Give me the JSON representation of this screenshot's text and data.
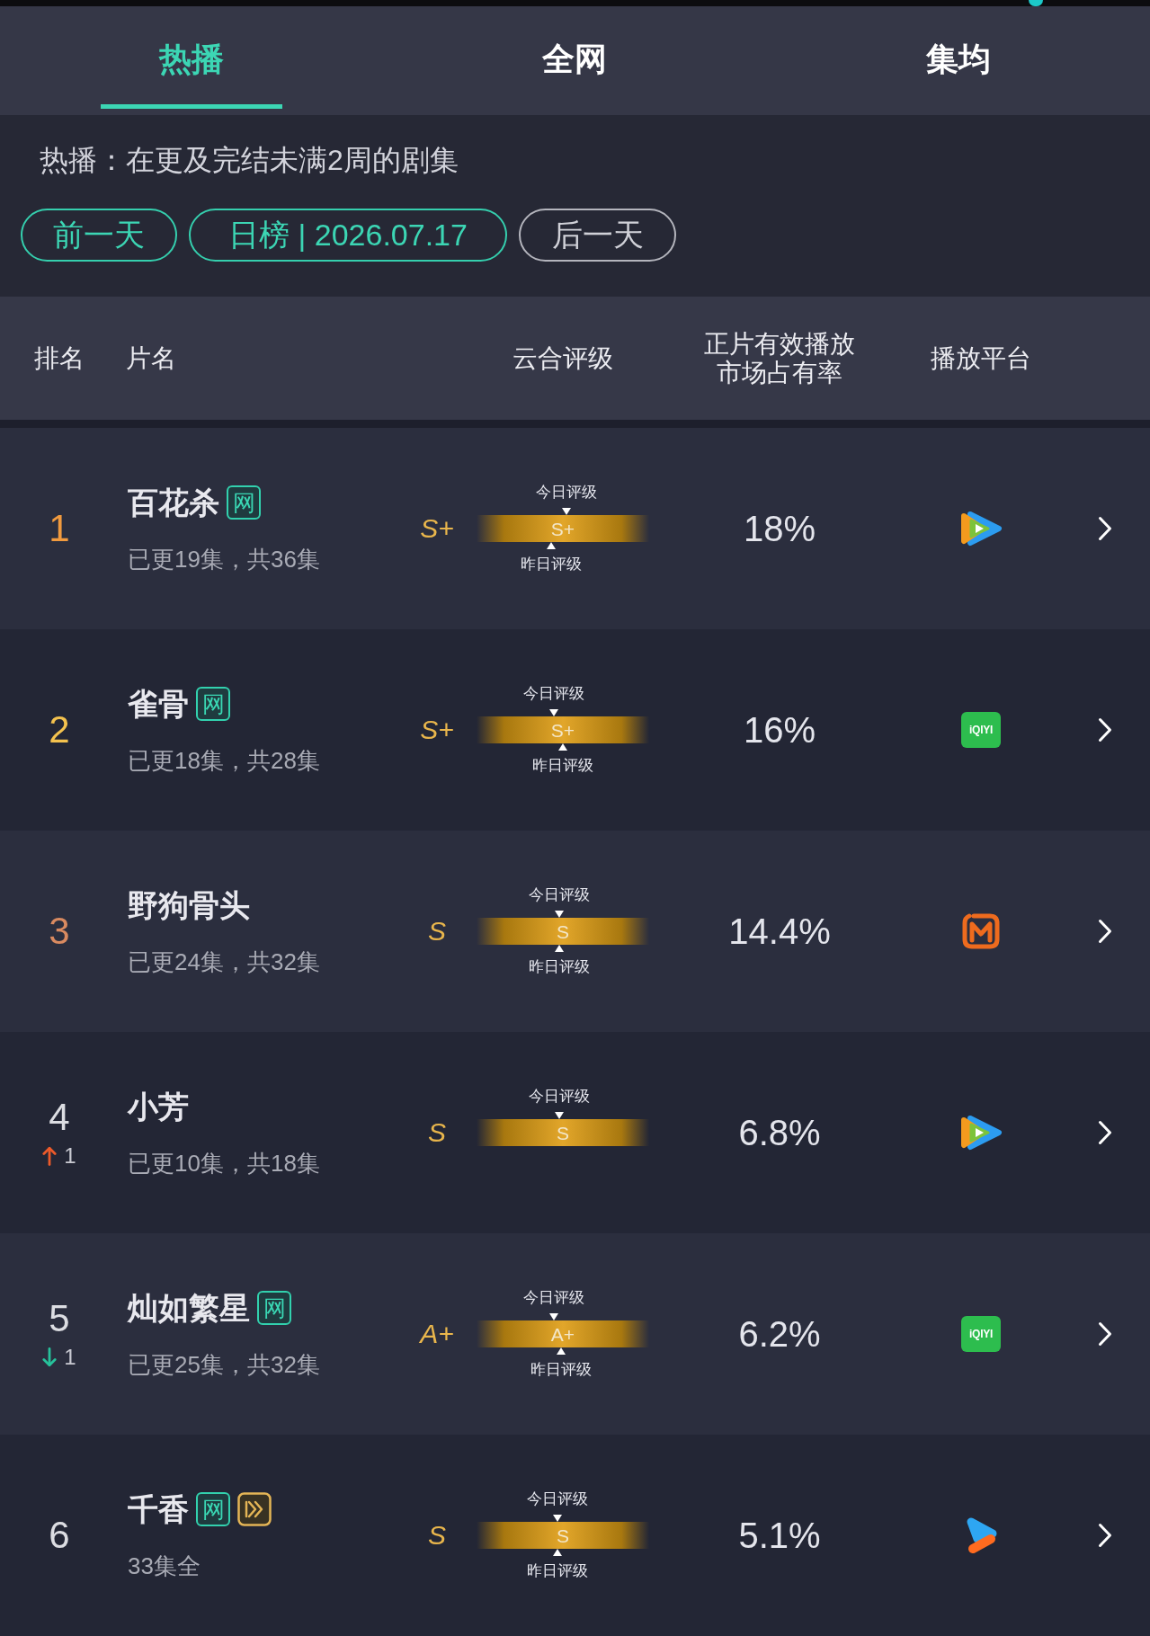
{
  "tabs": [
    {
      "label": "热播",
      "selected": true
    },
    {
      "label": "全网",
      "selected": false
    },
    {
      "label": "集均",
      "selected": false
    }
  ],
  "description": "热播：在更及完结未满2周的剧集",
  "date_buttons": [
    {
      "label": "前一天",
      "disabled": false
    },
    {
      "label": "日榜 | 2026.07.17",
      "disabled": false
    },
    {
      "label": "后一天",
      "disabled": true
    }
  ],
  "table": {
    "columns": [
      "排名",
      "片名",
      "云合评级",
      "正片有效播放市场占有率",
      "播放平台"
    ],
    "rows": [
      {
        "rank": "1",
        "color": "#f19a3e",
        "title": {
          "text": "百花杀",
          "tags": [
            {
              "kind": "text",
              "label": "网"
            }
          ]
        },
        "episodes": "已更19集，共36集",
        "grade": "S+",
        "rating": {
          "today": {
            "label": "今日评级",
            "level": 0.52
          },
          "bar_grade": "S+",
          "yesterday": {
            "label": "昨日评级",
            "level": 0.43
          }
        },
        "share": "18%",
        "platform": {
          "kind": "play_swirl"
        }
      },
      {
        "rank": "2",
        "color": "#f4c24e",
        "title": {
          "text": "雀骨",
          "tags": [
            {
              "kind": "text",
              "label": "网"
            }
          ]
        },
        "episodes": "已更18集，共28集",
        "grade": "S+",
        "rating": {
          "today": {
            "label": "今日评级",
            "level": 0.45
          },
          "bar_grade": "S+",
          "yesterday": {
            "label": "昨日评级",
            "level": 0.5
          }
        },
        "share": "16%",
        "platform": {
          "kind": "text_tile",
          "logo_text": "iQIYI"
        }
      },
      {
        "rank": "3",
        "color": "#d98a60",
        "title": {
          "text": "野狗骨头"
        },
        "episodes": "已更24集，共32集",
        "grade": "S",
        "rating": {
          "today": {
            "label": "今日评级",
            "level": 0.48
          },
          "bar_grade": "S",
          "yesterday": {
            "label": "昨日评级",
            "level": 0.48
          }
        },
        "share": "14.4%",
        "platform": {
          "kind": "m_frame"
        }
      },
      {
        "rank": "4",
        "color": "#dcdde2",
        "change": {
          "kind": "up",
          "value": "1"
        },
        "title": {
          "text": "小芳"
        },
        "episodes": "已更10集，共18集",
        "grade": "S",
        "rating": {
          "today": {
            "label": "今日评级",
            "level": 0.48
          },
          "bar_grade": "S"
        },
        "share": "6.8%",
        "platform": {
          "kind": "play_swirl"
        }
      },
      {
        "rank": "5",
        "color": "#dcdde2",
        "change": {
          "kind": "down",
          "value": "1"
        },
        "title": {
          "text": "灿如繁星",
          "tags": [
            {
              "kind": "text",
              "label": "网"
            }
          ]
        },
        "episodes": "已更25集，共32集",
        "grade": "A+",
        "rating": {
          "today": {
            "label": "今日评级",
            "level": 0.45
          },
          "bar_grade": "A+",
          "yesterday": {
            "label": "昨日评级",
            "level": 0.49
          }
        },
        "share": "6.2%",
        "platform": {
          "kind": "text_tile",
          "logo_text": "iQIYI"
        }
      },
      {
        "rank": "6",
        "color": "#dcdde2",
        "title": {
          "text": "千香",
          "tags": [
            {
              "kind": "text",
              "label": "网"
            },
            {
              "kind": "fast_forward"
            }
          ]
        },
        "episodes": "33集全",
        "grade": "S",
        "rating": {
          "today": {
            "label": "今日评级",
            "level": 0.47
          },
          "bar_grade": "S",
          "yesterday": {
            "label": "昨日评级",
            "level": 0.47
          }
        },
        "share": "5.1%",
        "platform": {
          "kind": "folded_play"
        }
      }
    ]
  }
}
